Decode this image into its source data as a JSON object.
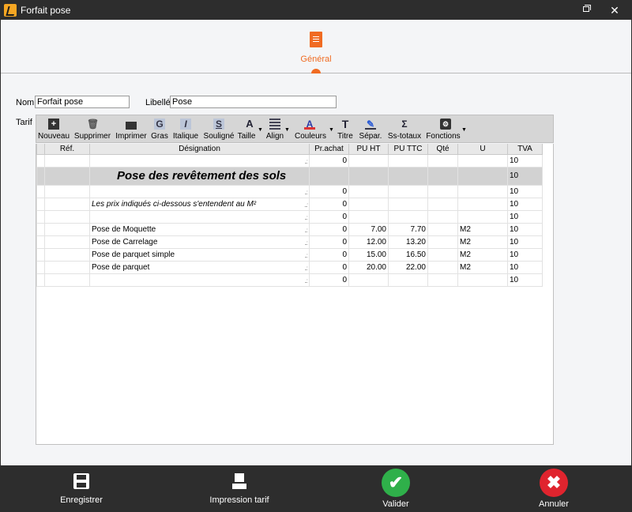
{
  "window": {
    "title": "Forfait pose"
  },
  "tabs": [
    {
      "label": "Général",
      "active": true
    }
  ],
  "form": {
    "nom_label": "Nom",
    "nom_value": "Forfait pose",
    "libelle_label": "Libellé",
    "libelle_value": "Pose",
    "tarif_label": "Tarif"
  },
  "toolbar": {
    "nouveau": "Nouveau",
    "supprimer": "Supprimer",
    "imprimer": "Imprimer",
    "gras": "Gras",
    "italique": "Italique",
    "souligne": "Souligné",
    "taille": "Taille",
    "align": "Align",
    "couleurs": "Couleurs",
    "titre": "Titre",
    "separ": "Sépar.",
    "ss_totaux": "Ss-totaux",
    "fonctions": "Fonctions"
  },
  "table": {
    "columns": [
      "Réf.",
      "Désignation",
      "Pr.achat",
      "PU HT",
      "PU TTC",
      "Qté",
      "U",
      "TVA"
    ],
    "rows": [
      {
        "ref": "",
        "designation": "",
        "prachat": "0",
        "puht": "",
        "puttc": "",
        "qte": "",
        "u": "",
        "tva": "10",
        "style": "normal"
      },
      {
        "ref": "",
        "designation": "Pose des revêtement des sols",
        "prachat": "",
        "puht": "",
        "puttc": "",
        "qte": "",
        "u": "",
        "tva": "10",
        "style": "title"
      },
      {
        "ref": "",
        "designation": "",
        "prachat": "0",
        "puht": "",
        "puttc": "",
        "qte": "",
        "u": "",
        "tva": "10",
        "style": "normal"
      },
      {
        "ref": "",
        "designation": "Les prix indiqués ci-dessous s'entendent au M²",
        "prachat": "0",
        "puht": "",
        "puttc": "",
        "qte": "",
        "u": "",
        "tva": "10",
        "style": "italic"
      },
      {
        "ref": "",
        "designation": "",
        "prachat": "0",
        "puht": "",
        "puttc": "",
        "qte": "",
        "u": "",
        "tva": "10",
        "style": "normal"
      },
      {
        "ref": "",
        "designation": "Pose de Moquette",
        "prachat": "0",
        "puht": "7.00",
        "puttc": "7.70",
        "qte": "",
        "u": "M2",
        "tva": "10",
        "style": "normal"
      },
      {
        "ref": "",
        "designation": "Pose de Carrelage",
        "prachat": "0",
        "puht": "12.00",
        "puttc": "13.20",
        "qte": "",
        "u": "M2",
        "tva": "10",
        "style": "normal"
      },
      {
        "ref": "",
        "designation": "Pose de parquet simple",
        "prachat": "0",
        "puht": "15.00",
        "puttc": "16.50",
        "qte": "",
        "u": "M2",
        "tva": "10",
        "style": "normal"
      },
      {
        "ref": "",
        "designation": "Pose de parquet",
        "prachat": "0",
        "puht": "20.00",
        "puttc": "22.00",
        "qte": "",
        "u": "M2",
        "tva": "10",
        "style": "normal"
      },
      {
        "ref": "",
        "designation": "",
        "prachat": "0",
        "puht": "",
        "puttc": "",
        "qte": "",
        "u": "",
        "tva": "10",
        "style": "normal"
      }
    ]
  },
  "footer": {
    "enregistrer": "Enregistrer",
    "impression": "Impression tarif",
    "valider": "Valider",
    "annuler": "Annuler"
  },
  "colors": {
    "accent": "#f06b22",
    "valider": "#2fb04a",
    "annuler": "#e0242e",
    "dark": "#2d2d2d"
  }
}
